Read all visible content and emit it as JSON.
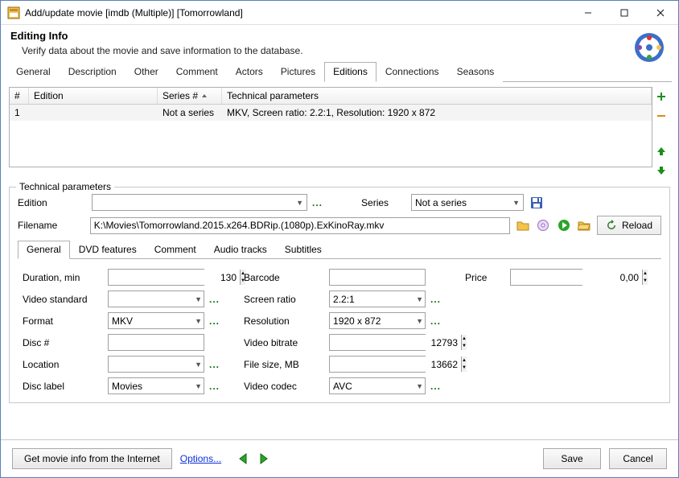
{
  "window": {
    "title": "Add/update movie [imdb (Multiple)] [Tomorrowland]"
  },
  "header": {
    "title": "Editing Info",
    "subtitle": "Verify data about the movie and save information to the database."
  },
  "tabs": [
    "General",
    "Description",
    "Other",
    "Comment",
    "Actors",
    "Pictures",
    "Editions",
    "Connections",
    "Seasons"
  ],
  "active_tab": "Editions",
  "grid": {
    "columns": {
      "num": "#",
      "edition": "Edition",
      "series": "Series #",
      "tech": "Technical parameters"
    },
    "rows": [
      {
        "num": "1",
        "edition": "",
        "series": "Not a series",
        "tech": "MKV, Screen ratio: 2.2:1, Resolution: 1920 x 872"
      }
    ]
  },
  "tech_params": {
    "legend": "Technical parameters",
    "edition_label": "Edition",
    "edition_value": "",
    "series_label": "Series",
    "series_value": "Not a series",
    "filename_label": "Filename",
    "filename_value": "K:\\Movies\\Tomorrowland.2015.x264.BDRip.(1080p).ExKinoRay.mkv",
    "reload_label": "Reload"
  },
  "subtabs": [
    "General",
    "DVD features",
    "Comment",
    "Audio tracks",
    "Subtitles"
  ],
  "active_subtab": "General",
  "fields": {
    "col1": {
      "duration_label": "Duration, min",
      "duration_value": "130",
      "video_standard_label": "Video standard",
      "video_standard_value": "",
      "format_label": "Format",
      "format_value": "MKV",
      "disc_num_label": "Disc #",
      "disc_num_value": "",
      "location_label": "Location",
      "location_value": "",
      "disc_label_label": "Disc label",
      "disc_label_value": "Movies"
    },
    "col2": {
      "barcode_label": "Barcode",
      "barcode_value": "",
      "screen_ratio_label": "Screen ratio",
      "screen_ratio_value": "2.2:1",
      "resolution_label": "Resolution",
      "resolution_value": "1920 x 872",
      "video_bitrate_label": "Video bitrate",
      "video_bitrate_value": "12793",
      "file_size_label": "File size, MB",
      "file_size_value": "13662",
      "video_codec_label": "Video codec",
      "video_codec_value": "AVC"
    },
    "col3": {
      "price_label": "Price",
      "price_value": "0,00"
    }
  },
  "footer": {
    "get_info": "Get movie info from the Internet",
    "options": "Options...",
    "save": "Save",
    "cancel": "Cancel"
  }
}
